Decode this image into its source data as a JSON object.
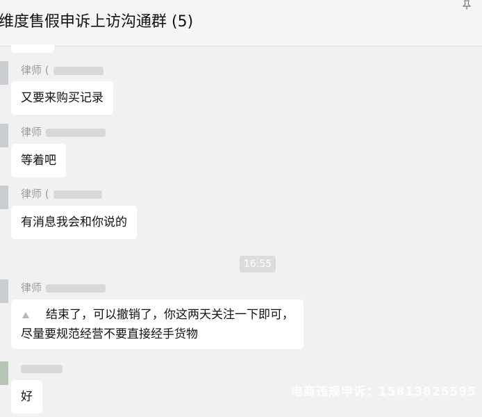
{
  "header": {
    "title": "维度售假申诉上访沟通群 (5)"
  },
  "messages": [
    {
      "sender": "律师",
      "sender_suffix": "(",
      "text": "又要来购买记录"
    },
    {
      "sender": "律师",
      "text": "等着吧"
    },
    {
      "sender": "律师",
      "sender_suffix": "(",
      "text": "有消息我会和你说的"
    },
    {
      "sender": "律师",
      "line1": "结束了，可以撤销了，你这两天关注一下即可，",
      "line2": "尽量要规范经营不要直接经手货物"
    },
    {
      "text": "好"
    }
  ],
  "time_divider": "16:55",
  "watermark": "电商违规申诉：15813825595",
  "icons": {
    "pin": "pin-icon"
  }
}
